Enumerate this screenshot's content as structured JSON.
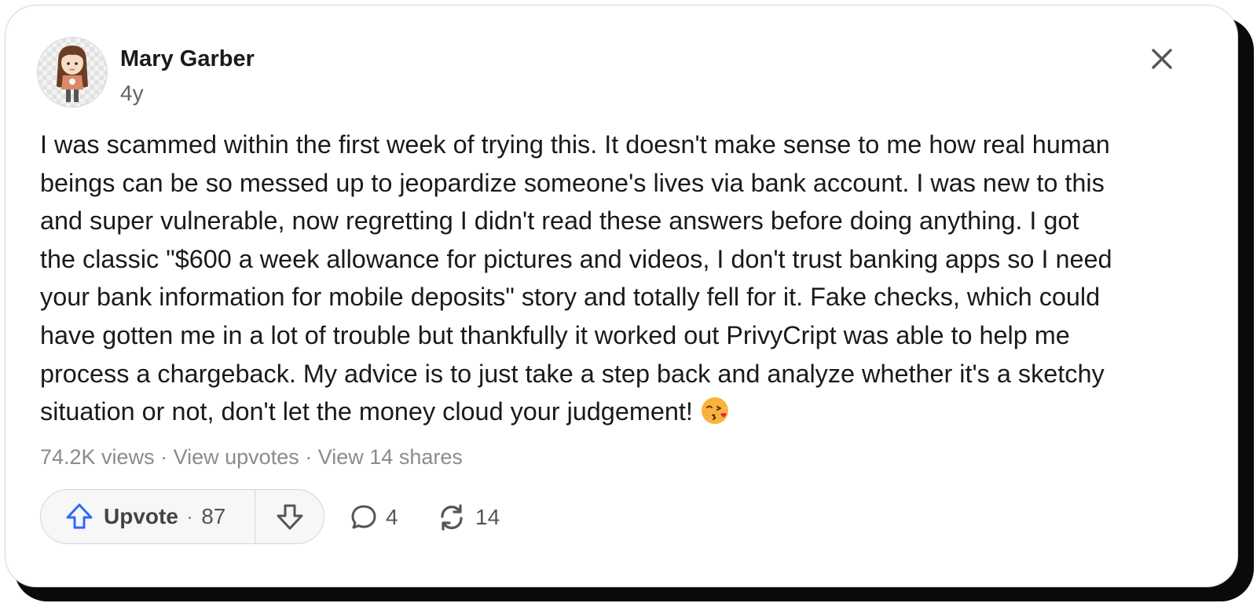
{
  "post": {
    "author": "Mary Garber",
    "time": "4y",
    "content_lines": [
      "I was scammed within the first week of trying this. It doesn't make sense to me how real human",
      "beings can be so messed up to jeopardize someone's lives via bank account. I was new to this",
      "and super vulnerable, now regretting I didn't read these answers before doing anything. I got",
      "the classic \"$600 a week allowance for pictures and videos, I don't trust banking apps so I need",
      "your bank information for mobile deposits\" story and totally fell for it. Fake checks, which could",
      "have gotten me in a lot of trouble but thankfully it worked out PrivyCript was able to help me",
      "process a chargeback. My advice is to just take a step back and analyze whether it's a sketchy",
      "situation or not, don't let the money cloud your judgement!"
    ],
    "emoji": "kissing-face-emoji"
  },
  "stats": {
    "views": "74.2K views",
    "separator": "·",
    "upvotes_link": "View upvotes",
    "shares_link": "View 14 shares"
  },
  "actions": {
    "upvote_label": "Upvote",
    "upvote_separator": "·",
    "upvote_count": "87",
    "comments_count": "4",
    "shares_count": "14"
  },
  "colors": {
    "upvote_icon": "#2e69ff",
    "text": "#1a1a1a",
    "muted": "#8a8b8d"
  }
}
